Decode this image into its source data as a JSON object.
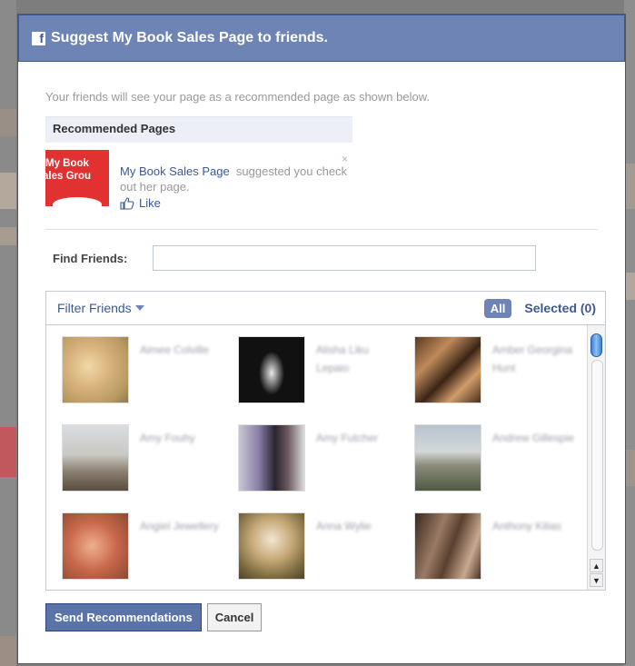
{
  "dialog": {
    "title": "Suggest My Book Sales Page to friends.",
    "intro": "Your friends will see your page as a recommended page as shown below."
  },
  "recommended": {
    "header": "Recommended Pages",
    "thumb_line1": "My Book",
    "thumb_line2": "ales Grou",
    "page_link": "My Book Sales Page",
    "suggest_text_1": "suggested you check",
    "suggest_text_2": "out her page.",
    "like_label": "Like",
    "close_glyph": "×"
  },
  "find": {
    "label": "Find Friends:",
    "value": "",
    "placeholder": ""
  },
  "friends_panel": {
    "filter_label": "Filter Friends",
    "tab_all": "All",
    "tab_selected": "Selected (0)",
    "friends": [
      {
        "name": "Aimee Colville"
      },
      {
        "name": "Alisha Liku Lepaio"
      },
      {
        "name": "Amber Georgina Hunt"
      },
      {
        "name": "Amy Fouhy"
      },
      {
        "name": "Amy Futcher"
      },
      {
        "name": "Andrew Gillespie"
      },
      {
        "name": "Angiel Jewellery"
      },
      {
        "name": "Anna Wylie"
      },
      {
        "name": "Anthony Kilias"
      }
    ]
  },
  "buttons": {
    "send": "Send Recommendations",
    "cancel": "Cancel"
  },
  "colors": {
    "titlebar": "#6d84b4",
    "link": "#3b5998",
    "thumb_red": "#e23131"
  }
}
